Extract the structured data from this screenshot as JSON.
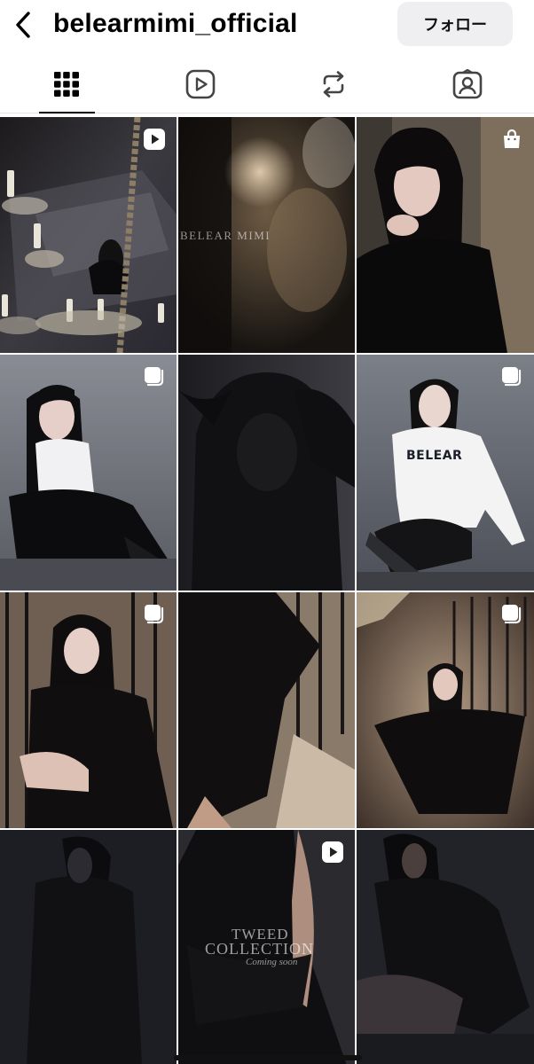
{
  "header": {
    "username": "belearmimi_official",
    "follow_label": "フォロー"
  },
  "tabs": [
    {
      "name": "posts",
      "icon": "grid-icon",
      "active": true
    },
    {
      "name": "reels",
      "icon": "reels-play-icon",
      "active": false
    },
    {
      "name": "reposts",
      "icon": "repost-icon",
      "active": false
    },
    {
      "name": "tagged",
      "icon": "tagged-person-icon",
      "active": false
    }
  ],
  "posts": [
    {
      "badge": "reel-icon"
    },
    {
      "badge": "none",
      "overlay_text": "BELEAR MIMI"
    },
    {
      "badge": "shopping-bag-icon"
    },
    {
      "badge": "carousel-icon"
    },
    {
      "badge": "none"
    },
    {
      "badge": "carousel-icon",
      "sweater_text": "BELEAR"
    },
    {
      "badge": "carousel-icon"
    },
    {
      "badge": "none"
    },
    {
      "badge": "carousel-icon"
    },
    {
      "badge": "none"
    },
    {
      "badge": "reel-icon",
      "overlay_title_1": "TWEED",
      "overlay_title_2": "COLLECTION",
      "overlay_subtitle": "Coming soon"
    },
    {
      "badge": "none"
    }
  ],
  "colors": {
    "follow_bg": "#efeff2",
    "active_tab": "#000000"
  }
}
